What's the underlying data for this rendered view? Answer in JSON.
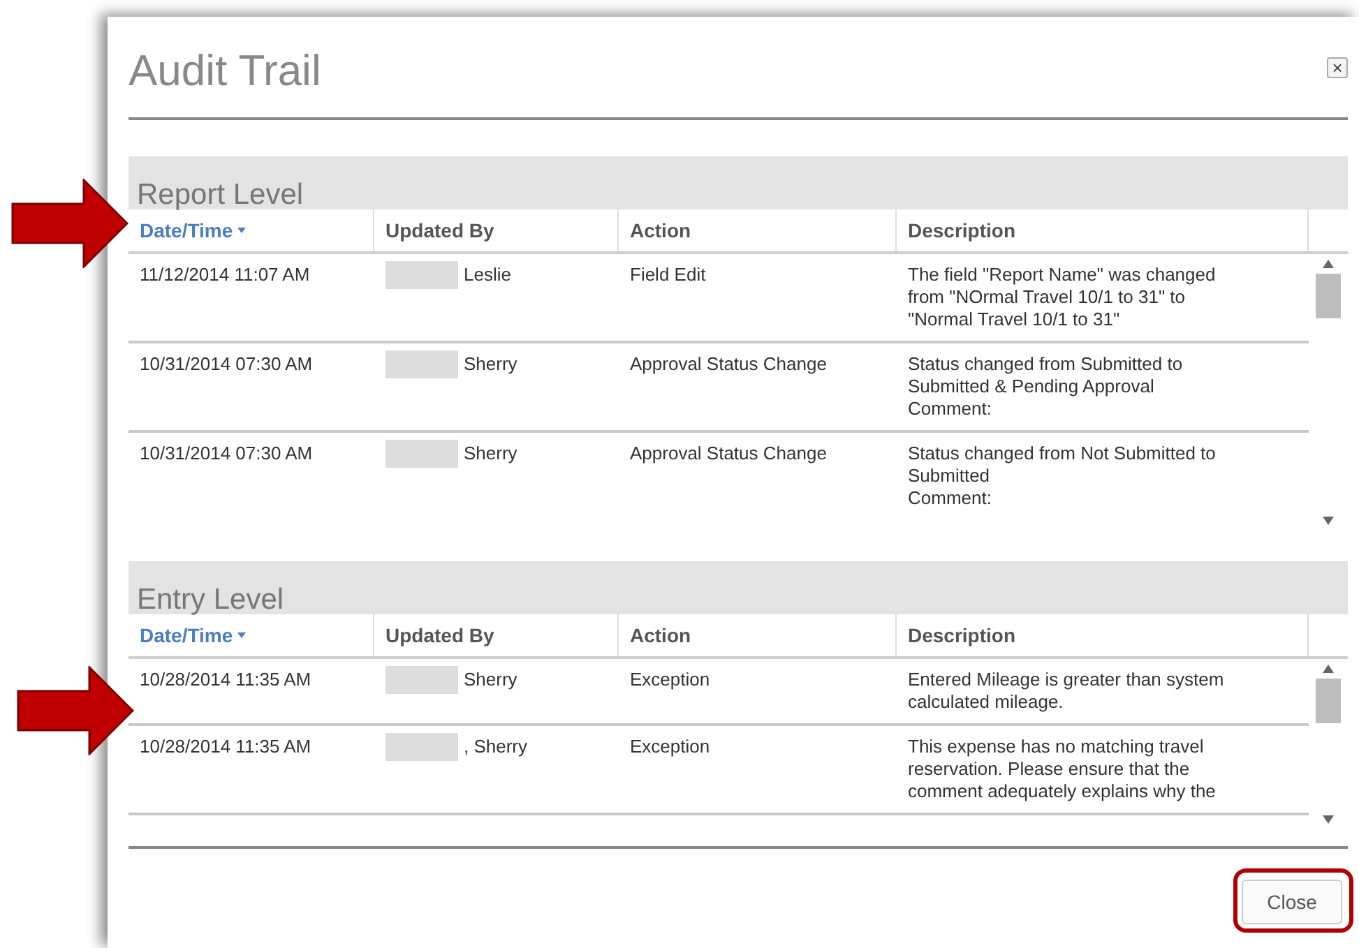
{
  "window": {
    "title": "Audit Trail",
    "close_icon": "×"
  },
  "sections": [
    {
      "title": "Report Level",
      "columns": [
        {
          "label": "Date/Time",
          "sorted": true
        },
        {
          "label": "Updated By",
          "sorted": false
        },
        {
          "label": "Action",
          "sorted": false
        },
        {
          "label": "Description",
          "sorted": false
        }
      ],
      "rows": [
        {
          "date": "11/12/2014 11:07 AM",
          "updated_by": "Leslie",
          "action": "Field Edit",
          "description": "The field \"Report Name\" was changed\nfrom \"NOrmal Travel 10/1 to 31\" to\n\"Normal Travel 10/1 to 31\""
        },
        {
          "date": "10/31/2014 07:30 AM",
          "updated_by": "Sherry",
          "action": "Approval Status Change",
          "description": "Status changed from Submitted to\nSubmitted & Pending Approval\nComment:"
        },
        {
          "date": "10/31/2014 07:30 AM",
          "updated_by": "Sherry",
          "action": "Approval Status Change",
          "description": "Status changed from Not Submitted to\nSubmitted\nComment:"
        }
      ]
    },
    {
      "title": "Entry Level",
      "columns": [
        {
          "label": "Date/Time",
          "sorted": true
        },
        {
          "label": "Updated By",
          "sorted": false
        },
        {
          "label": "Action",
          "sorted": false
        },
        {
          "label": "Description",
          "sorted": false
        }
      ],
      "rows": [
        {
          "date": "10/28/2014 11:35 AM",
          "updated_by": "Sherry",
          "action": "Exception",
          "description": "Entered Mileage is greater than system\ncalculated mileage."
        },
        {
          "date": "10/28/2014 11:35 AM",
          "updated_by": ", Sherry",
          "action": "Exception",
          "description": "This expense has no matching travel\nreservation. Please ensure that the\ncomment adequately explains why the"
        }
      ]
    }
  ],
  "buttons": [
    {
      "label": "Close"
    }
  ]
}
